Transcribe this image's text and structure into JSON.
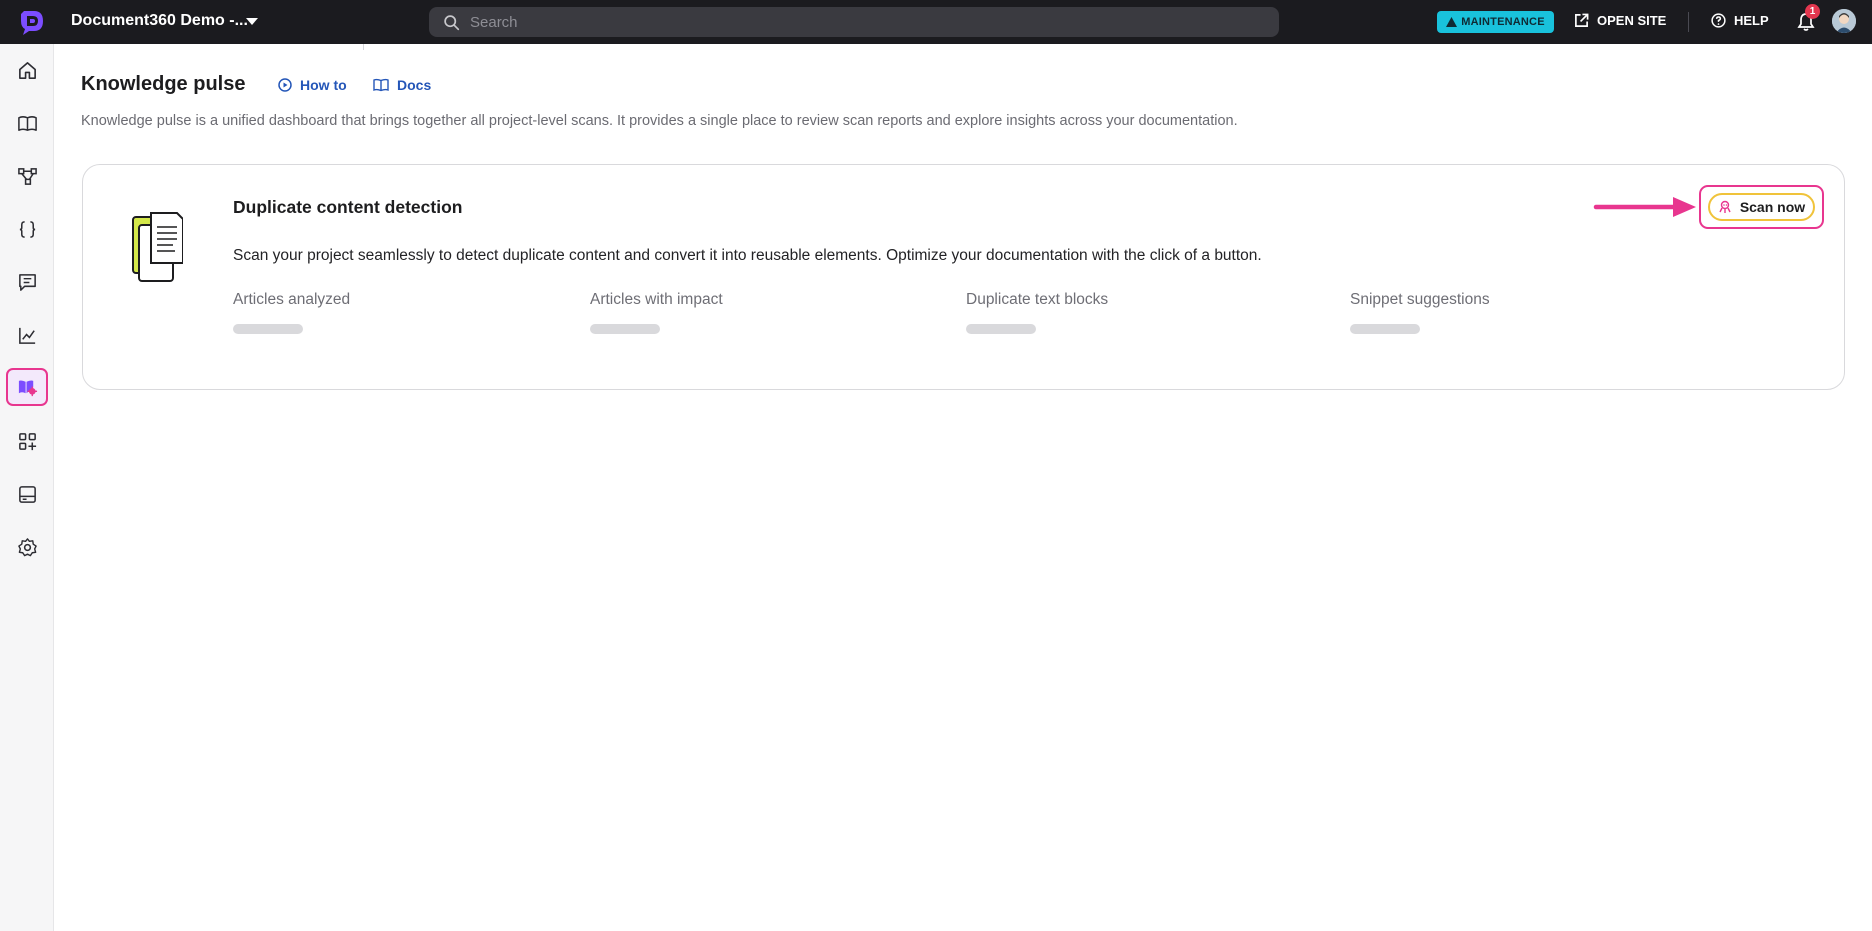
{
  "topbar": {
    "project_name": "Document360 Demo -...",
    "search_placeholder": "Search",
    "maintenance_label": "MAINTENANCE",
    "open_site_label": "OPEN SITE",
    "help_label": "HELP",
    "notification_count": "1"
  },
  "sidebar": {
    "items": [
      {
        "icon": "home-icon"
      },
      {
        "icon": "book-icon"
      },
      {
        "icon": "workflow-icon"
      },
      {
        "icon": "braces-icon"
      },
      {
        "icon": "comment-icon"
      },
      {
        "icon": "analytics-icon"
      },
      {
        "icon": "knowledge-pulse-icon",
        "active": true
      },
      {
        "icon": "apps-add-icon"
      },
      {
        "icon": "widget-icon"
      },
      {
        "icon": "settings-icon"
      }
    ]
  },
  "page": {
    "title": "Knowledge pulse",
    "how_to_label": "How to",
    "docs_label": "Docs",
    "description": "Knowledge pulse is a unified dashboard that brings together all project-level scans. It provides a single place to review scan reports and explore insights across your documentation."
  },
  "card": {
    "title": "Duplicate content detection",
    "description": "Scan your project seamlessly to detect duplicate content and convert it into reusable elements. Optimize your documentation with the click of a button.",
    "scan_button_label": "Scan now",
    "metrics": [
      {
        "label": "Articles analyzed"
      },
      {
        "label": "Articles with impact"
      },
      {
        "label": "Duplicate text blocks"
      },
      {
        "label": "Snippet suggestions"
      }
    ]
  },
  "colors": {
    "accent_pink": "#e8368f",
    "link_blue": "#2456b8",
    "maintenance_cyan": "#19c2dc",
    "topbar_bg": "#1b1b1f",
    "scan_button_border": "#f0c33a"
  }
}
